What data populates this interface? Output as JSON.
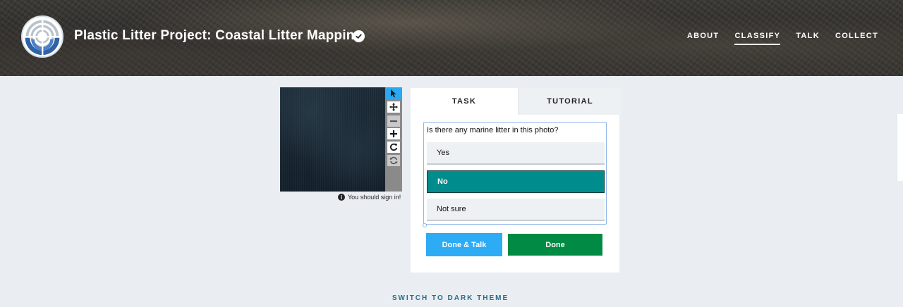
{
  "header": {
    "project_title": "Plastic Litter Project: Coastal Litter Mapping",
    "verified_icon": "check-circle-icon",
    "nav": [
      {
        "label": "ABOUT",
        "active": false
      },
      {
        "label": "CLASSIFY",
        "active": true
      },
      {
        "label": "TALK",
        "active": false
      },
      {
        "label": "COLLECT",
        "active": false
      }
    ]
  },
  "viewer": {
    "tools": [
      "pointer-icon",
      "move-icon",
      "zoom-out-icon",
      "zoom-in-icon",
      "rotate-icon",
      "reset-icon"
    ],
    "active_tool": "pointer-icon",
    "notice": "You should sign in!"
  },
  "task_panel": {
    "tabs": {
      "task": "TASK",
      "tutorial": "TUTORIAL"
    },
    "active_tab": "TASK",
    "question": "Is there any marine litter in this photo?",
    "answers": [
      {
        "label": "Yes",
        "selected": false
      },
      {
        "label": "No",
        "selected": true
      },
      {
        "label": "Not sure",
        "selected": false
      }
    ],
    "buttons": {
      "done_talk": "Done & Talk",
      "done": "Done"
    }
  },
  "footer": {
    "theme_toggle": "SWITCH TO DARK THEME"
  },
  "colors": {
    "accent_blue": "#2dabf5",
    "selected_teal": "#008c8c",
    "done_green": "#008a44",
    "page_bg": "#eaeef2"
  }
}
